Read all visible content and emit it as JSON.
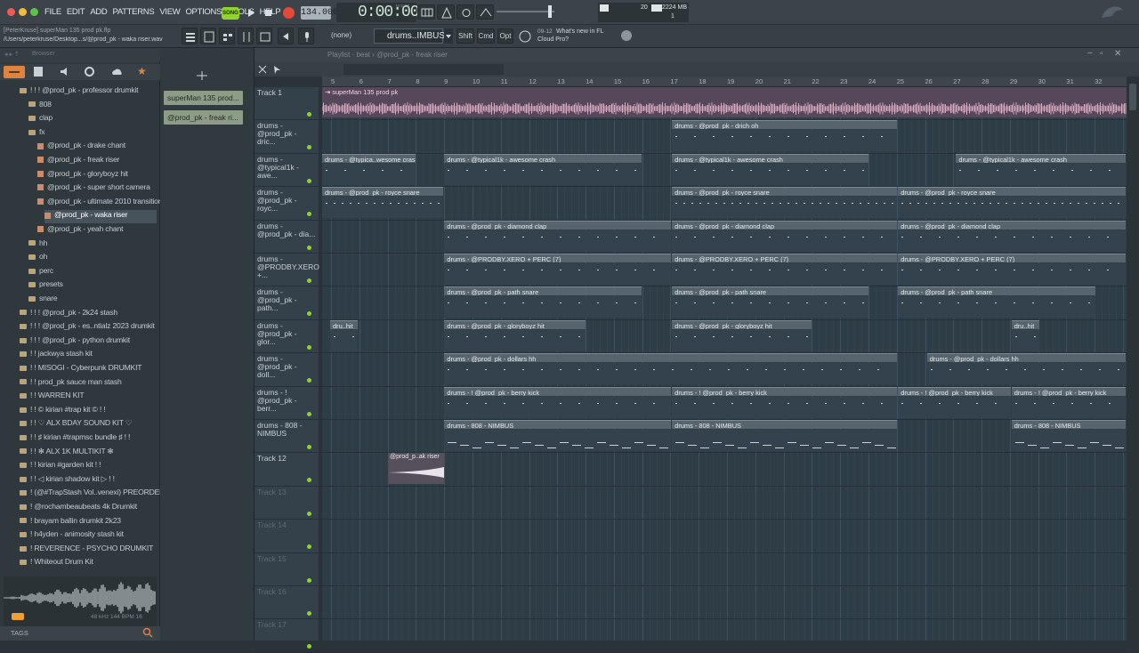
{
  "topbar": {
    "menu": [
      "FILE",
      "EDIT",
      "ADD",
      "PATTERNS",
      "VIEW",
      "OPTIONS",
      "TOOLS",
      "HELP"
    ],
    "song_label": "SONG",
    "tempo": "134.000",
    "time": "0:00:00",
    "time_sub": "M:S:CS",
    "cpu": "20",
    "memory": "2224 MB",
    "voices": "1",
    "project_user": "[PeterKruse] superMan 135 prod pk.flp",
    "project_path": "/Users/peterkruse/Desktop...s/@prod_pk - waka riser.wav",
    "pattern_none": "(none)",
    "pattern_select": "drums..IMBUS",
    "shift": "Shift",
    "cmd": "Cmd",
    "opt": "Opt",
    "news_date": "09-12",
    "news_title": "What's new in FL",
    "news_sub": "Cloud Pro?"
  },
  "browser": {
    "title": "Browser",
    "items": [
      {
        "label": "! ! ! @prod_pk - professor drumkit",
        "type": "folder"
      },
      {
        "label": "808",
        "type": "folder"
      },
      {
        "label": "clap",
        "type": "folder"
      },
      {
        "label": "fx",
        "type": "folder"
      },
      {
        "label": "@prod_pk - drake chant",
        "type": "wav"
      },
      {
        "label": "@prod_pk - freak riser",
        "type": "wav"
      },
      {
        "label": "@prod_pk - gloryboyz hit",
        "type": "wav"
      },
      {
        "label": "@prod_pk - super short camera",
        "type": "wav"
      },
      {
        "label": "@prod_pk - ultimate 2010 transition",
        "type": "wav"
      },
      {
        "label": "@prod_pk - waka riser",
        "type": "wav-selected"
      },
      {
        "label": "@prod_pk - yeah chant",
        "type": "wav"
      },
      {
        "label": "hh",
        "type": "folder"
      },
      {
        "label": "oh",
        "type": "folder"
      },
      {
        "label": "perc",
        "type": "folder"
      },
      {
        "label": "presets",
        "type": "folder"
      },
      {
        "label": "snare",
        "type": "folder"
      },
      {
        "label": "! ! ! @prod_pk - 2k24 stash",
        "type": "folder"
      },
      {
        "label": "! ! ! @prod_pk - es..ntialz 2023 drumkit",
        "type": "folder"
      },
      {
        "label": "! ! ! @prod_pk - python drumkit",
        "type": "folder"
      },
      {
        "label": "! ! jackwya stash kit",
        "type": "folder"
      },
      {
        "label": "! ! MISOGI - Cyberpunk DRUMKIT",
        "type": "folder"
      },
      {
        "label": "! ! prod_pk sauce man stash",
        "type": "folder"
      },
      {
        "label": "! ! WARREN KIT",
        "type": "folder"
      },
      {
        "label": "! ! © kirian #trap kit © ! !",
        "type": "folder"
      },
      {
        "label": "! ! ♡ ALX BDAY SOUND KIT ♡",
        "type": "folder"
      },
      {
        "label": "! ! ♯ kirian #trapmsc bundle ♯ ! !",
        "type": "folder"
      },
      {
        "label": "! ! ✻ ALX 1K MULTIKIT ✻",
        "type": "folder"
      },
      {
        "label": "! ! kirian #garden kit ! !",
        "type": "folder"
      },
      {
        "label": "! ! ◁ kirian shadow kit ▷ ! !",
        "type": "folder"
      },
      {
        "label": "! (@#TrapStash Vol..venexi) PREORDER",
        "type": "folder"
      },
      {
        "label": "! @rochambeaubeats 4k Drumkit",
        "type": "folder"
      },
      {
        "label": "! brayam ballin drumkit 2k23",
        "type": "folder"
      },
      {
        "label": "! h4yden - animosity stash kit",
        "type": "folder"
      },
      {
        "label": "! REVERENCE - PSYCHO DRUMKIT",
        "type": "folder"
      },
      {
        "label": "! Whiteout Drum Kit",
        "type": "folder"
      }
    ],
    "sample_info": "48 kHz 144 BPM 16",
    "tags_label": "TAGS"
  },
  "channels": [
    {
      "label": "superMan 135 prod..."
    },
    {
      "label": "@prod_pk - freak ri..."
    }
  ],
  "playlist": {
    "title": "Playlist · beat › @prod_pk - freak riser",
    "ruler": [
      "5",
      "6",
      "7",
      "8",
      "9",
      "10",
      "11",
      "12",
      "13",
      "14",
      "15",
      "16",
      "17",
      "18",
      "19",
      "20",
      "21",
      "22",
      "23",
      "24",
      "25",
      "26",
      "27",
      "28",
      "29",
      "30",
      "31",
      "32"
    ],
    "tracks": [
      {
        "name": "Track 1"
      },
      {
        "name": "drums - @prod_pk - dric..."
      },
      {
        "name": "drums - @typical1k - awe..."
      },
      {
        "name": "drums - @prod_pk - royc..."
      },
      {
        "name": "drums - @prod_pk - dia..."
      },
      {
        "name": "drums - @PRODBY.XERO +..."
      },
      {
        "name": "drums - @prod_pk - path..."
      },
      {
        "name": "drums - @prod_pk - glor..."
      },
      {
        "name": "drums - @prod_pk - doll..."
      },
      {
        "name": "drums - ! @prod_pk - berr..."
      },
      {
        "name": "drums - 808 - NIMBUS"
      },
      {
        "name": "Track 12"
      },
      {
        "name": "Track 13"
      },
      {
        "name": "Track 14"
      },
      {
        "name": "Track 15"
      },
      {
        "name": "Track 16"
      },
      {
        "name": "Track 17"
      }
    ],
    "audio_clip": "superMan 135 prod pk",
    "riser_clip": "@prod_p..ak riser",
    "clips": [
      {
        "track": 1,
        "start": 0.435,
        "end": 0.716,
        "label": "drums - @prod_pk - drich oh"
      },
      {
        "track": 2,
        "start": 0.0,
        "end": 0.117,
        "label": "drums - @typica..wesome crash"
      },
      {
        "track": 2,
        "start": 0.152,
        "end": 0.398,
        "label": "drums - @typical1k - awesome crash"
      },
      {
        "track": 2,
        "start": 0.435,
        "end": 0.68,
        "label": "drums - @typical1k - awesome crash"
      },
      {
        "track": 2,
        "start": 0.788,
        "end": 1.0,
        "label": "drums - @typical1k - awesome crash"
      },
      {
        "track": 3,
        "start": 0.0,
        "end": 0.152,
        "label": "drums - @prod_pk - royce snare"
      },
      {
        "track": 3,
        "start": 0.435,
        "end": 0.716,
        "label": "drums - @prod_pk - royce snare"
      },
      {
        "track": 3,
        "start": 0.716,
        "end": 1.0,
        "label": "drums - @prod_pk - royce snare"
      },
      {
        "track": 4,
        "start": 0.152,
        "end": 0.435,
        "label": "drums - @prod_pk - diamond clap"
      },
      {
        "track": 4,
        "start": 0.435,
        "end": 0.716,
        "label": "drums - @prod_pk - diamond clap"
      },
      {
        "track": 4,
        "start": 0.716,
        "end": 1.0,
        "label": "drums - @prod_pk - diamond clap"
      },
      {
        "track": 5,
        "start": 0.152,
        "end": 0.435,
        "label": "drums - @PRODBY.XERO + PERC (7)"
      },
      {
        "track": 5,
        "start": 0.435,
        "end": 0.716,
        "label": "drums - @PRODBY.XERO + PERC (7)"
      },
      {
        "track": 5,
        "start": 0.716,
        "end": 1.0,
        "label": "drums - @PRODBY.XERO + PERC (7)"
      },
      {
        "track": 6,
        "start": 0.152,
        "end": 0.398,
        "label": "drums - @prod_pk - path snare"
      },
      {
        "track": 6,
        "start": 0.435,
        "end": 0.68,
        "label": "drums - @prod_pk - path snare"
      },
      {
        "track": 6,
        "start": 0.716,
        "end": 0.962,
        "label": "drums - @prod_pk - path snare"
      },
      {
        "track": 7,
        "start": 0.01,
        "end": 0.045,
        "label": "dru..hit"
      },
      {
        "track": 7,
        "start": 0.152,
        "end": 0.328,
        "label": "drums - @prod_pk - gloryboyz hit"
      },
      {
        "track": 7,
        "start": 0.435,
        "end": 0.61,
        "label": "drums - @prod_pk - gloryboyz hit"
      },
      {
        "track": 7,
        "start": 0.857,
        "end": 0.893,
        "label": "dru..hit"
      },
      {
        "track": 8,
        "start": 0.152,
        "end": 0.716,
        "label": "drums - @prod_pk - dollars hh"
      },
      {
        "track": 8,
        "start": 0.752,
        "end": 1.0,
        "label": "drums - @prod_pk - dollars hh"
      },
      {
        "track": 9,
        "start": 0.152,
        "end": 0.435,
        "label": "drums - ! @prod_pk - berry kick"
      },
      {
        "track": 9,
        "start": 0.435,
        "end": 0.716,
        "label": "drums - ! @prod_pk - berry kick"
      },
      {
        "track": 9,
        "start": 0.716,
        "end": 0.857,
        "label": "drums - ! @prod_pk - berry kick"
      },
      {
        "track": 9,
        "start": 0.857,
        "end": 1.0,
        "label": "drums - ! @prod_pk - berry kick"
      },
      {
        "track": 10,
        "start": 0.152,
        "end": 0.435,
        "label": "drums - 808 - NIMBUS"
      },
      {
        "track": 10,
        "start": 0.435,
        "end": 0.716,
        "label": "drums - 808 - NIMBUS"
      },
      {
        "track": 10,
        "start": 0.857,
        "end": 1.0,
        "label": "drums - 808 - NIMBUS"
      }
    ]
  },
  "colors": {
    "accent_green": "#8ed42c",
    "record_red": "#e04a3a",
    "audio_track": "#d7a9bd",
    "clip_gray": "#58646d"
  }
}
